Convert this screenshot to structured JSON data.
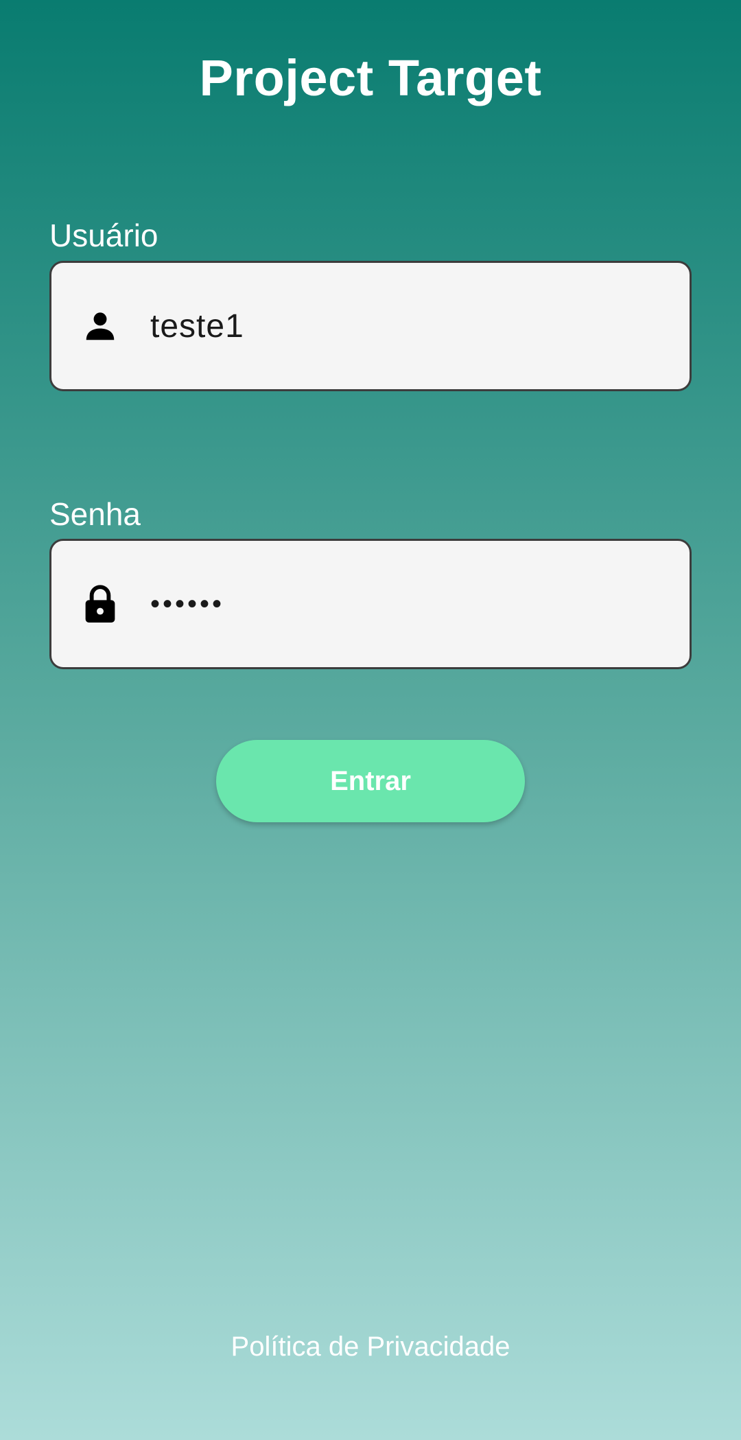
{
  "app": {
    "title": "Project Target"
  },
  "login_form": {
    "username": {
      "label": "Usuário",
      "value": "teste1",
      "icon": "person-icon"
    },
    "password": {
      "label": "Senha",
      "value": "••••••",
      "icon": "lock-icon"
    },
    "submit_label": "Entrar"
  },
  "footer": {
    "privacy_link": "Política de Privacidade"
  },
  "colors": {
    "gradient_top": "#097c70",
    "gradient_bottom": "#acdcd9",
    "button": "#6ae6ad",
    "field_background": "#f5f5f5"
  }
}
